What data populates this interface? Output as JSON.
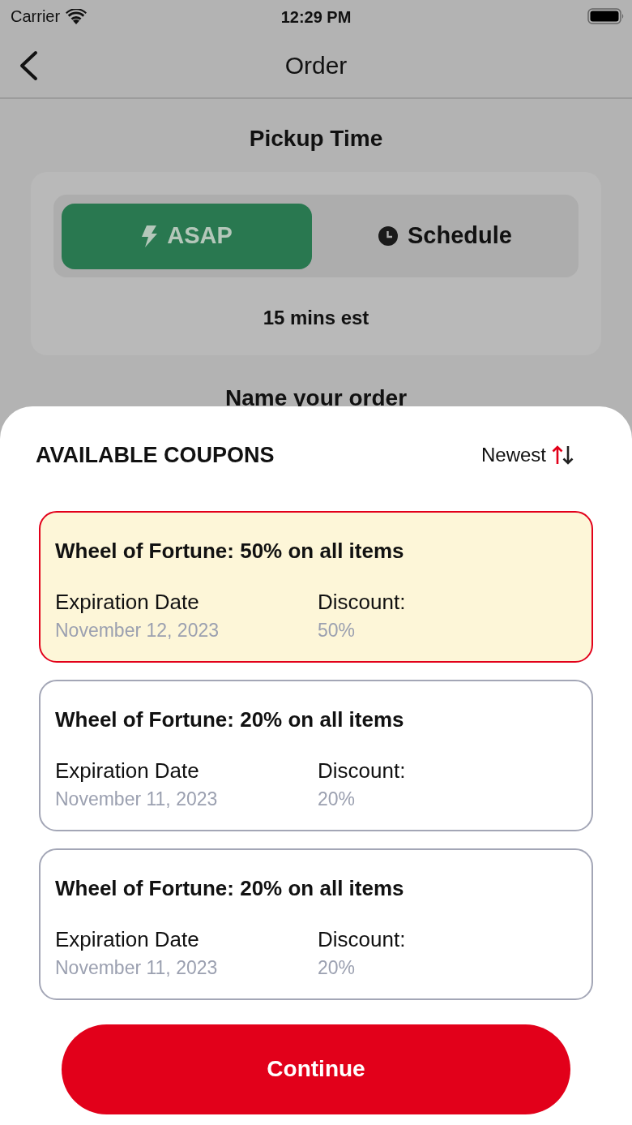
{
  "status_bar": {
    "carrier": "Carrier",
    "time": "12:29 PM"
  },
  "nav_bar": {
    "title": "Order"
  },
  "pickup": {
    "title": "Pickup Time",
    "options": [
      {
        "label": "ASAP",
        "kind": "bolt",
        "selected": true
      },
      {
        "label": "Schedule",
        "kind": "clock",
        "selected": false
      }
    ],
    "estimate": "15 mins est"
  },
  "name_order": {
    "title": "Name your order"
  },
  "coupons_sheet": {
    "title": "AVAILABLE COUPONS",
    "sort": {
      "label": "Newest"
    },
    "coupons": [
      {
        "title": "Wheel of Fortune: 50% on all items",
        "expiration_label": "Expiration Date",
        "expiration": "November 12, 2023",
        "discount_label": "Discount:",
        "discount": "50%",
        "selected": true
      },
      {
        "title": "Wheel of Fortune: 20% on all items",
        "expiration_label": "Expiration Date",
        "expiration": "November 11, 2023",
        "discount_label": "Discount:",
        "discount": "20%",
        "selected": false
      },
      {
        "title": "Wheel of Fortune: 20% on all items",
        "expiration_label": "Expiration Date",
        "expiration": "November 11, 2023",
        "discount_label": "Discount:",
        "discount": "20%",
        "selected": false
      }
    ]
  },
  "continue_button": {
    "label": "Continue"
  }
}
